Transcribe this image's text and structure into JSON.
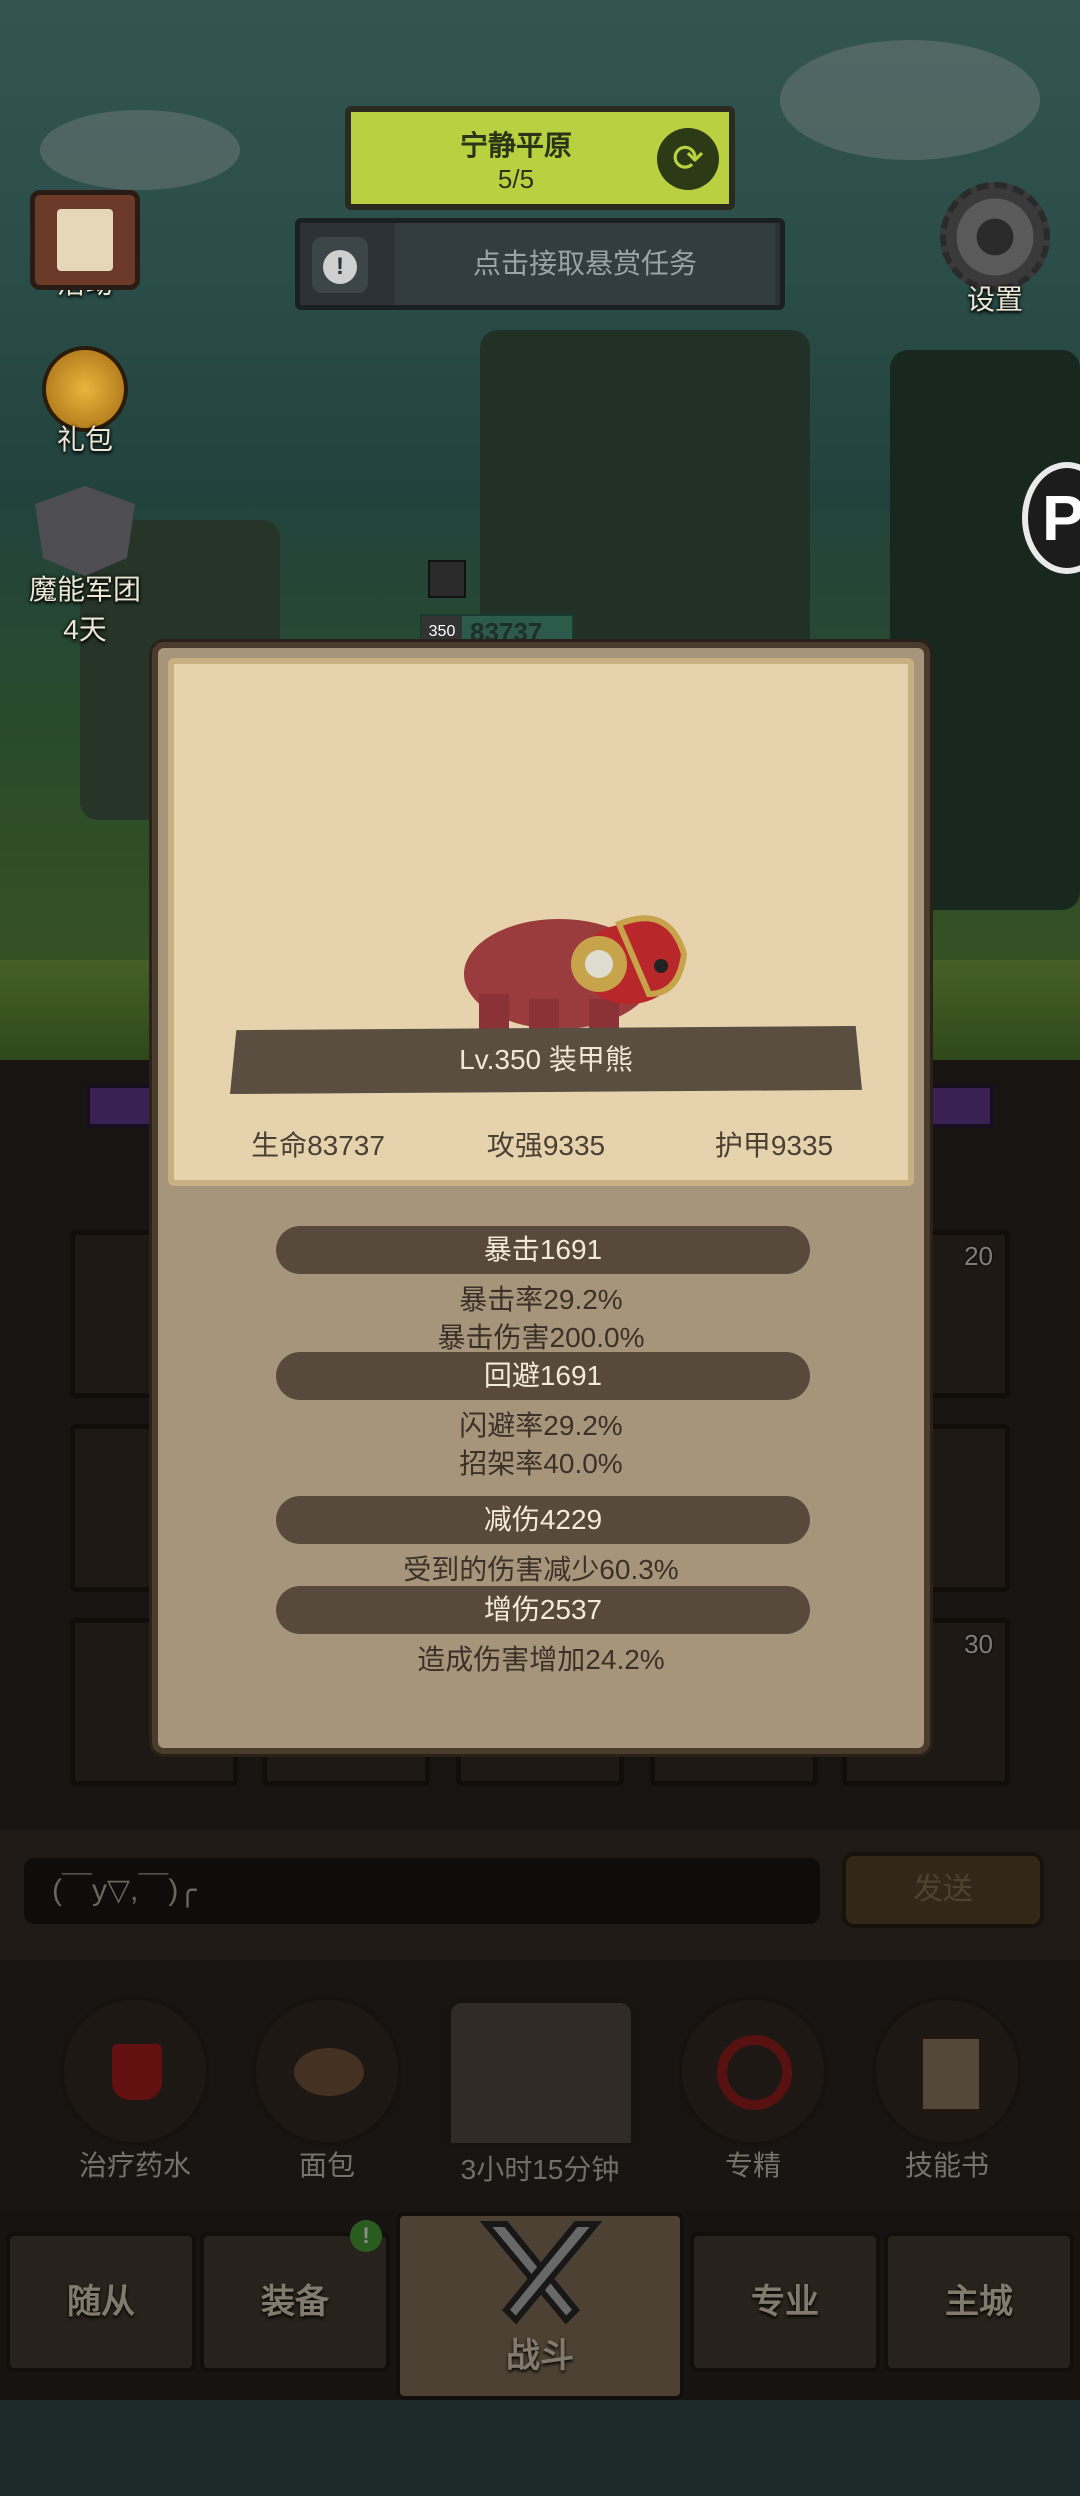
{
  "hud": {
    "map_name": "宁静平原",
    "map_progress": "5/5",
    "bounty_task": "点击接取悬赏任务",
    "side_left": [
      {
        "label": "活动",
        "icon": "scroll-board-icon"
      },
      {
        "label": "礼包",
        "icon": "gift-coin-icon"
      },
      {
        "label": "魔能军团",
        "sub": "4天",
        "icon": "legion-helmet-icon"
      }
    ],
    "settings_label": "设置",
    "p_badge": "P",
    "enemy_level": "350",
    "enemy_hp_display": "83737"
  },
  "modal": {
    "monster_name": "Lv.350 装甲熊",
    "stats": [
      {
        "label": "生命83737"
      },
      {
        "label": "攻强9335"
      },
      {
        "label": "护甲9335"
      }
    ],
    "details": [
      {
        "header": "暴击1691",
        "lines": [
          "暴击率29.2%",
          "暴击伤害200.0%"
        ]
      },
      {
        "header": "回避1691",
        "lines": [
          "闪避率29.2%",
          "招架率40.0%"
        ]
      },
      {
        "header": "减伤4229",
        "lines": [
          "受到的伤害减少60.3%"
        ]
      },
      {
        "header": "增伤2537",
        "lines": [
          "造成伤害增加24.2%"
        ]
      }
    ]
  },
  "grid": {
    "slot_numbers": [
      "20",
      "30"
    ]
  },
  "chat": {
    "input_value": "(￣y▽,￣)╭",
    "send_label": "发送"
  },
  "quick": {
    "items": [
      {
        "label": "治疗药水",
        "icon": "potion-icon"
      },
      {
        "label": "面包",
        "icon": "bread-icon"
      },
      {
        "label": "专精",
        "icon": "specialization-icon"
      },
      {
        "label": "技能书",
        "icon": "skill-book-icon"
      }
    ],
    "chest_timer": "3小时15分钟"
  },
  "tabs": {
    "items": [
      "随从",
      "装备",
      "战斗",
      "专业",
      "主城"
    ],
    "active": "战斗",
    "equip_badge": "!"
  },
  "colors": {
    "map_box": "#b9d141",
    "modal_bg": "#a6957a",
    "parchment": "#e6d3ad",
    "pill": "#574a3d",
    "badge": "#4fa83a"
  }
}
